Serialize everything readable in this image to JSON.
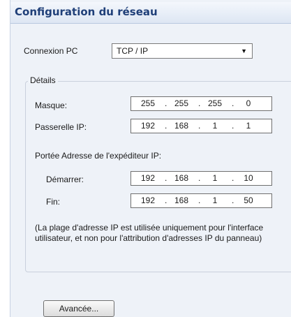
{
  "header": {
    "title": "Configuration du réseau"
  },
  "connection": {
    "label": "Connexion PC",
    "selected": "TCP / IP"
  },
  "details": {
    "caption": "Détails",
    "mask": {
      "label": "Masque:",
      "octets": [
        "255",
        "255",
        "255",
        "0"
      ]
    },
    "gateway": {
      "label": "Passerelle IP:",
      "octets": [
        "192",
        "168",
        "1",
        "1"
      ]
    },
    "range_label": "Portée Adresse de l'expéditeur IP:",
    "start": {
      "label": "Démarrer:",
      "octets": [
        "192",
        "168",
        "1",
        "10"
      ]
    },
    "end": {
      "label": "Fin:",
      "octets": [
        "192",
        "168",
        "1",
        "50"
      ]
    },
    "note": "(La plage d'adresse IP est utilisée uniquement pour l'interface utilisateur, et non pour l'attribution d'adresses IP du panneau)"
  },
  "advanced_button": {
    "label": "Avancée..."
  },
  "icons": {
    "dropdown": "chevron-down-icon"
  },
  "colors": {
    "header_text": "#1f3f78",
    "panel_bg": "#eef2f8"
  }
}
